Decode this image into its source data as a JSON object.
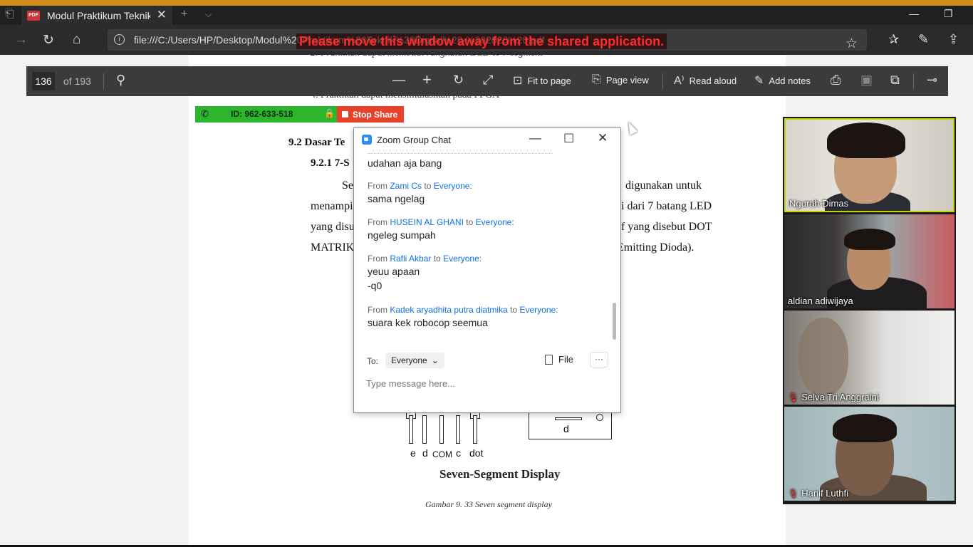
{
  "browser": {
    "tab_title": "Modul Praktikum Teknik",
    "tab_close": "✕",
    "new_tab_icon": "+",
    "url": "file:///C:/Users/HP/Desktop/Modul%20Praktikum%20Teknik%20Digital%20-%202020%20.pdf",
    "zoom_warning": "Please move this window away from the shared application."
  },
  "pdf_toolbar": {
    "page_number": "136",
    "page_of": "of 193",
    "fit_to_page": "Fit to page",
    "page_view": "Page view",
    "read_aloud": "Read aloud",
    "add_notes": "Add notes"
  },
  "document": {
    "fragment_top": "2.   Praktikan dapat membuat rangkaian BCD to 7 segment",
    "fragment_second": "4.   Praktikan dapat mensimulasikan pada FPGA",
    "heading_92": "9.2  Dasar Te",
    "heading_921": "9.2.1  7-S",
    "para_line1_left": "Se",
    "para_line1_right": "digunakan  untuk",
    "para_line2_left": "menampi",
    "para_line2_right": "i dari 7 batang LED",
    "para_line3_left": "yang disu",
    "para_line3_right": "f yang disebut DOT",
    "para_line4_left": "MATRIK",
    "para_line4_right": "Emitting Dioda).",
    "pin_labels": [
      "e",
      "d",
      "COM",
      "c",
      "dot"
    ],
    "segment_label": "d",
    "caption_title": "Seven-Segment Display",
    "caption_figure": "Gambar 9. 33 Seven segment display"
  },
  "share_bar": {
    "meeting_id": "ID: 962-633-518",
    "stop_share": "Stop Share"
  },
  "chat": {
    "title": "Zoom Group Chat",
    "first_partial": "udahan aja bang",
    "from_word": "From",
    "to_word": "to",
    "messages": [
      {
        "sender": "Zami Cs",
        "recipient": "Everyone:",
        "lines": [
          "sama ngelag"
        ]
      },
      {
        "sender": "HUSEIN AL GHANI",
        "recipient": "Everyone:",
        "lines": [
          "ngeleg sumpah"
        ]
      },
      {
        "sender": "Rafli Akbar",
        "recipient": "Everyone:",
        "lines": [
          "yeuu apaan",
          "-q0"
        ]
      },
      {
        "sender": "Kadek aryadhita putra diatmika",
        "recipient": "Everyone:",
        "lines": [
          "suara kek robocop seemua"
        ]
      }
    ],
    "to_label": "To:",
    "to_value": "Everyone",
    "file_label": "File",
    "more_label": "···",
    "input_placeholder": "Type message here..."
  },
  "participants": [
    {
      "name": "Ngurah Dimas",
      "muted": false,
      "active": true
    },
    {
      "name": "aldian adiwijaya",
      "muted": false,
      "active": false
    },
    {
      "name": "Selva Tri Anggraini",
      "muted": true,
      "active": false
    },
    {
      "name": "Hanif Luthfi",
      "muted": true,
      "active": false
    }
  ],
  "colors": {
    "accent_strip": "#d18a1c",
    "zoom_green": "#2db52d",
    "stop_share_red": "#e8412a",
    "zoom_blue": "#0e71eb",
    "warning_red": "#ff2a2a",
    "active_speaker": "#c8d400"
  }
}
